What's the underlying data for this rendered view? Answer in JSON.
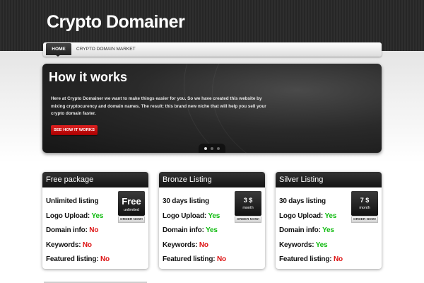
{
  "header": {
    "logo": "Crypto Domainer"
  },
  "nav": {
    "items": [
      "HOME",
      "CRYPTO DOMAIN MARKET"
    ]
  },
  "slider": {
    "title": "How it works",
    "text": "Here at Crypto Domainer we want to make things easier for you. So we have created this website by mixing cryptocurency and domain names. The result: this brand new niche that will help you sell your crypto domain faster.",
    "button": "SEE HOW IT WORKS",
    "dots": 3,
    "active_dot": 0
  },
  "cards": [
    {
      "title": "Free package",
      "price": "Free",
      "unit": "unlimited",
      "order": "ORDER NOW!",
      "features": [
        {
          "label": "Unlimited listing",
          "value": ""
        },
        {
          "label": "Logo Upload: ",
          "value": "Yes"
        },
        {
          "label": "Domain info: ",
          "value": "No"
        },
        {
          "label": "Keywords: ",
          "value": "No"
        },
        {
          "label": "Featured listing: ",
          "value": "No"
        }
      ]
    },
    {
      "title": "Bronze Listing",
      "price": "3 $",
      "unit": "month",
      "order": "ORDER NOW!",
      "features": [
        {
          "label": "30 days listing",
          "value": ""
        },
        {
          "label": "Logo Upload: ",
          "value": "Yes"
        },
        {
          "label": "Domain info: ",
          "value": "Yes"
        },
        {
          "label": "Keywords: ",
          "value": "No"
        },
        {
          "label": "Featured listing: ",
          "value": "No"
        }
      ]
    },
    {
      "title": "Silver Listing",
      "price": "7 $",
      "unit": "month",
      "order": "ORDER NOW!",
      "features": [
        {
          "label": "30 days listing",
          "value": ""
        },
        {
          "label": "Logo Upload: ",
          "value": "Yes"
        },
        {
          "label": "Domain info: ",
          "value": "Yes"
        },
        {
          "label": "Keywords: ",
          "value": "Yes"
        },
        {
          "label": "Featured listing: ",
          "value": "No"
        }
      ]
    }
  ],
  "colors": {
    "yes": "#11bb11",
    "no": "#dd1111",
    "accent": "#cc1111"
  }
}
